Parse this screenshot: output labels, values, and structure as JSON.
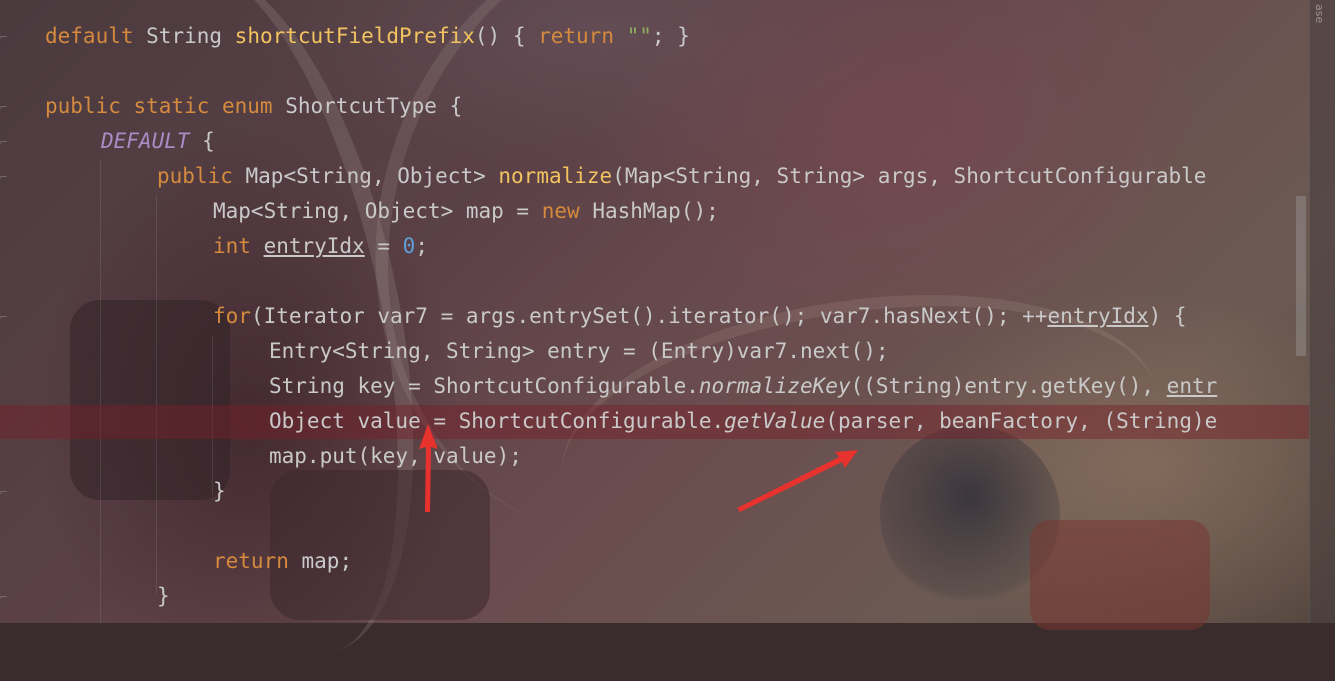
{
  "editor": {
    "side_label": "ase",
    "lines": {
      "l1": {
        "kw1": "default ",
        "t1": "String ",
        "fn": "shortcutFieldPrefix",
        "t2": "() { ",
        "kw2": "return ",
        "str": "\"\"",
        "t3": "; }"
      },
      "l3": {
        "kw1": "public static enum ",
        "t1": "ShortcutType {"
      },
      "l4": {
        "enumc": "DEFAULT",
        "t1": " {"
      },
      "l5": {
        "kw1": "public ",
        "t1": "Map<String, Object> ",
        "fn": "normalize",
        "t2": "(Map<String, String> args, ShortcutConfigurable"
      },
      "l6": {
        "t1": "Map<String, Object> map = ",
        "kw1": "new ",
        "t2": "HashMap();"
      },
      "l7": {
        "kw1": "int ",
        "ul": "entryIdx",
        "t1": " = ",
        "num": "0",
        "t2": ";"
      },
      "l9": {
        "kw1": "for",
        "t1": "(Iterator var7 = args.entrySet().iterator(); var7.hasNext(); ++",
        "ul": "entryIdx",
        "t2": ") {"
      },
      "l10": {
        "t1": "Entry<String, String> entry = (Entry)var7.next();"
      },
      "l11": {
        "t1": "String key = ShortcutConfigurable.",
        "it": "normalizeKey",
        "t2": "((String)entry.getKey(), ",
        "ul": "entr"
      },
      "l12": {
        "t1": "Object value = ShortcutConfigurable.",
        "it": "getValue",
        "t2": "(parser, beanFactory, (String)e"
      },
      "l13": {
        "t1": "map.put(key, value);"
      },
      "l14": {
        "t1": "}"
      },
      "l16": {
        "kw1": "return ",
        "t1": "map;"
      },
      "l17": {
        "t1": "}"
      }
    }
  },
  "annotations": {
    "arrow_color": "#e8322e"
  }
}
